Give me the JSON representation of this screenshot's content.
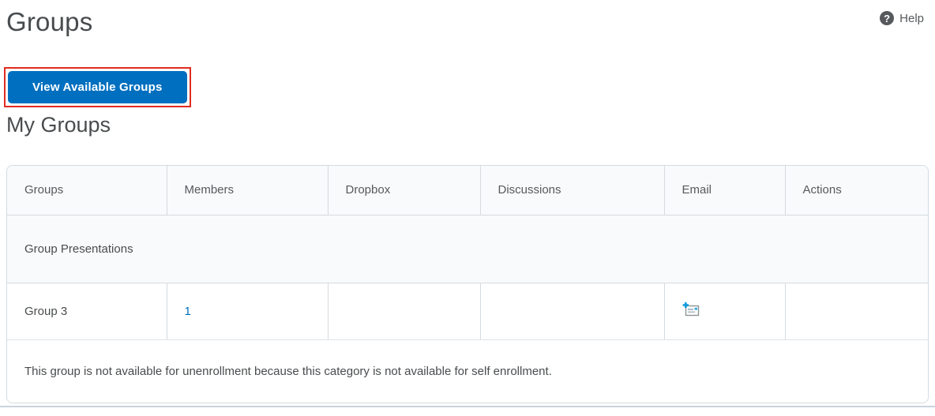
{
  "page": {
    "title": "Groups",
    "help_label": "Help",
    "view_available_groups_button": "View Available Groups",
    "my_groups_heading": "My Groups"
  },
  "table": {
    "columns": [
      "Groups",
      "Members",
      "Dropbox",
      "Discussions",
      "Email",
      "Actions"
    ],
    "category_row": {
      "label": "Group Presentations"
    },
    "group_row": {
      "name": "Group 3",
      "members_count": "1",
      "dropbox": "",
      "discussions": "",
      "email_icon": "email-compose-icon",
      "actions": ""
    },
    "footer_note": "This group is not available for unenrollment because this category is not available for self enrollment."
  },
  "icons": {
    "help": "help-question-circle-icon",
    "email": "email-compose-icon"
  },
  "colors": {
    "accent_blue": "#006fbf",
    "annotation_red": "#e02b20",
    "header_bg": "#f9fafb",
    "table_border": "#d4dbe0",
    "text_primary": "#494c4e",
    "text_secondary": "#565a5c",
    "help_icon_bg": "#56595b",
    "bottom_divider": "#c9d3dc"
  }
}
